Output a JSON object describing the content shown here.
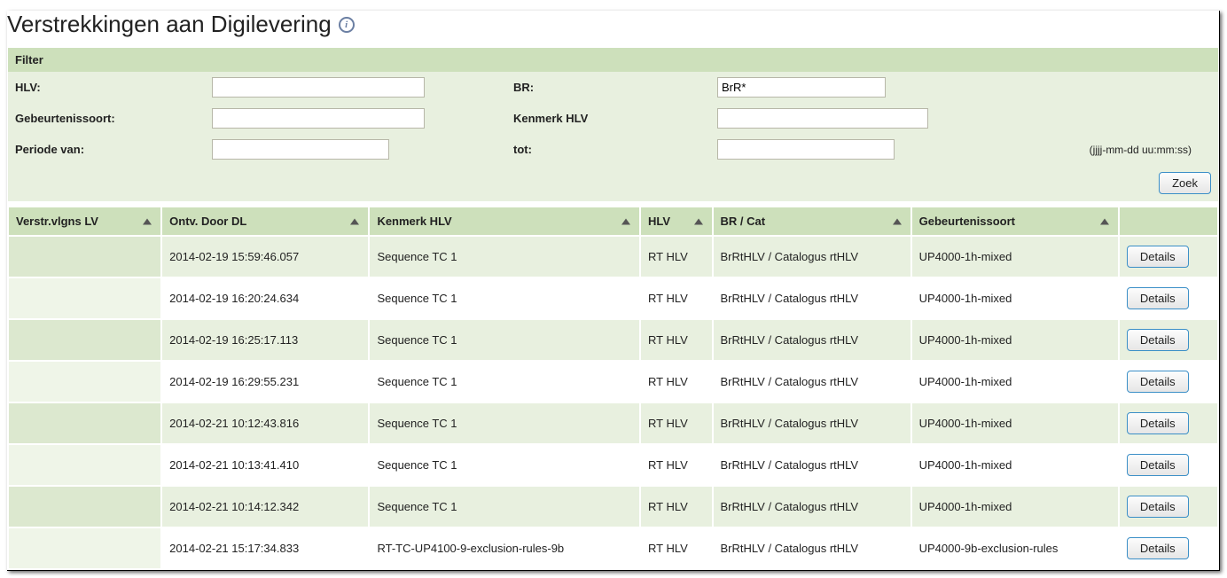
{
  "page": {
    "title": "Verstrekkingen aan Digilevering"
  },
  "filter": {
    "header": "Filter",
    "hlv_label": "HLV:",
    "hlv_value": "",
    "br_label": "BR:",
    "br_value": "BrR*",
    "gebeurtenissoort_label": "Gebeurtenissoort:",
    "gebeurtenissoort_value": "",
    "kenmerk_label": "Kenmerk HLV",
    "kenmerk_value": "",
    "periode_van_label": "Periode van:",
    "periode_van_value": "",
    "tot_label": "tot:",
    "tot_value": "",
    "periode_hint": "(jjjj-mm-dd uu:mm:ss)",
    "zoek": "Zoek"
  },
  "table": {
    "headers": {
      "verstr": "Verstr.vlgns LV",
      "ontv": "Ontv. Door DL",
      "kenmerk": "Kenmerk HLV",
      "hlv": "HLV",
      "brcat": "BR / Cat",
      "geb": "Gebeurtenissoort"
    },
    "details_label": "Details",
    "rows": [
      {
        "verstr": "",
        "ontv": "2014-02-19 15:59:46.057",
        "kenmerk": "Sequence TC 1",
        "hlv": "RT HLV",
        "brcat": "BrRtHLV / Catalogus rtHLV",
        "geb": "UP4000-1h-mixed"
      },
      {
        "verstr": "",
        "ontv": "2014-02-19 16:20:24.634",
        "kenmerk": "Sequence TC 1",
        "hlv": "RT HLV",
        "brcat": "BrRtHLV / Catalogus rtHLV",
        "geb": "UP4000-1h-mixed"
      },
      {
        "verstr": "",
        "ontv": "2014-02-19 16:25:17.113",
        "kenmerk": "Sequence TC 1",
        "hlv": "RT HLV",
        "brcat": "BrRtHLV / Catalogus rtHLV",
        "geb": "UP4000-1h-mixed"
      },
      {
        "verstr": "",
        "ontv": "2014-02-19 16:29:55.231",
        "kenmerk": "Sequence TC 1",
        "hlv": "RT HLV",
        "brcat": "BrRtHLV / Catalogus rtHLV",
        "geb": "UP4000-1h-mixed"
      },
      {
        "verstr": "",
        "ontv": "2014-02-21 10:12:43.816",
        "kenmerk": "Sequence TC 1",
        "hlv": "RT HLV",
        "brcat": "BrRtHLV / Catalogus rtHLV",
        "geb": "UP4000-1h-mixed"
      },
      {
        "verstr": "",
        "ontv": "2014-02-21 10:13:41.410",
        "kenmerk": "Sequence TC 1",
        "hlv": "RT HLV",
        "brcat": "BrRtHLV / Catalogus rtHLV",
        "geb": "UP4000-1h-mixed"
      },
      {
        "verstr": "",
        "ontv": "2014-02-21 10:14:12.342",
        "kenmerk": "Sequence TC 1",
        "hlv": "RT HLV",
        "brcat": "BrRtHLV / Catalogus rtHLV",
        "geb": "UP4000-1h-mixed"
      },
      {
        "verstr": "",
        "ontv": "2014-02-21 15:17:34.833",
        "kenmerk": "RT-TC-UP4100-9-exclusion-rules-9b",
        "hlv": "RT HLV",
        "brcat": "BrRtHLV / Catalogus rtHLV",
        "geb": "UP4000-9b-exclusion-rules"
      }
    ]
  }
}
